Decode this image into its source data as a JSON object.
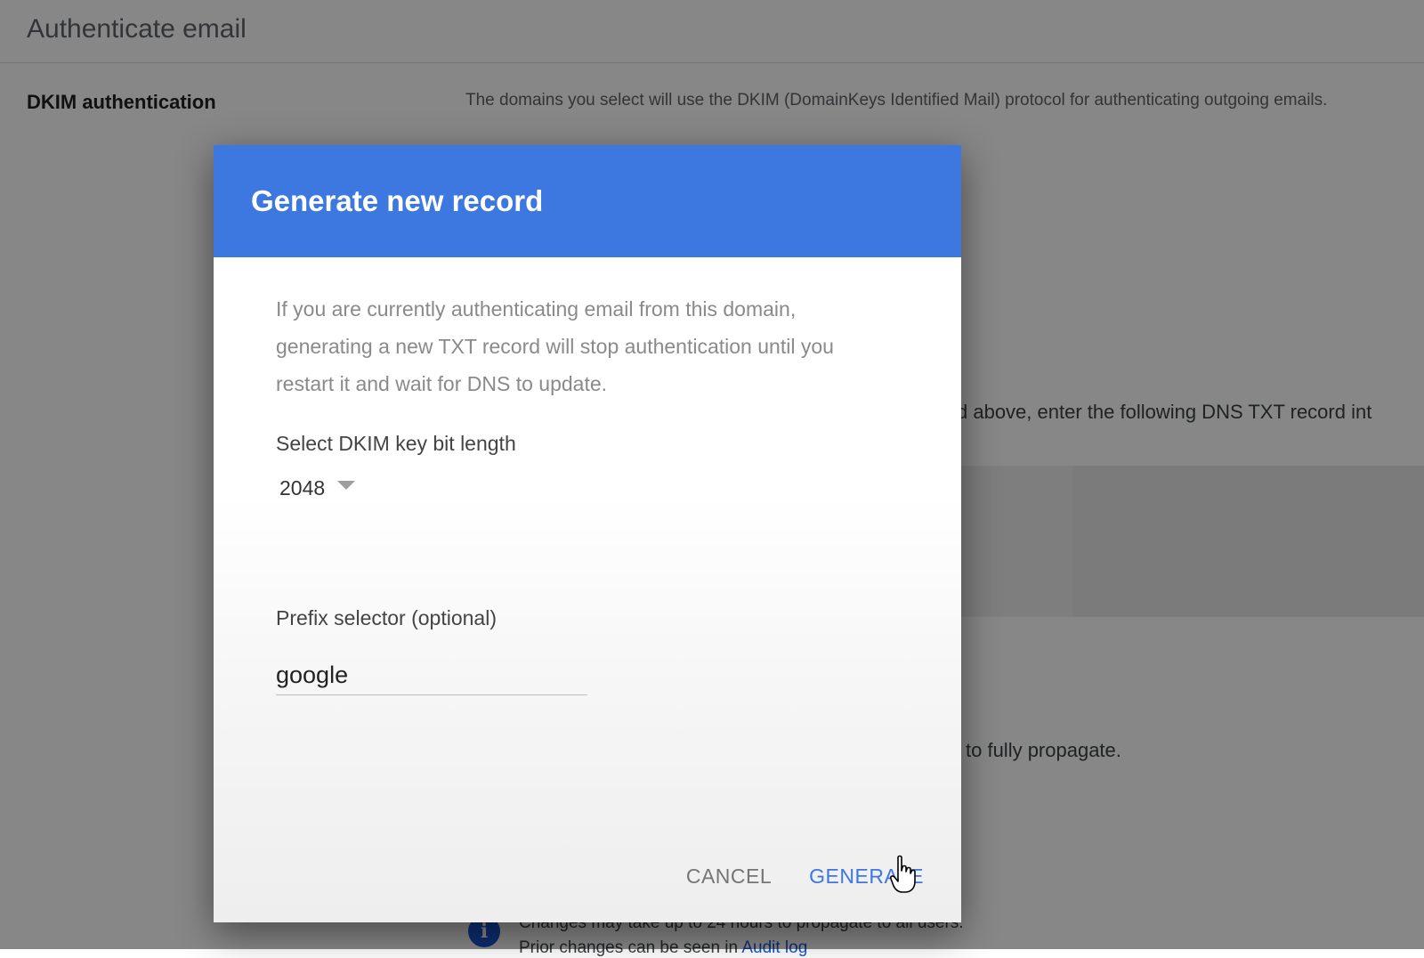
{
  "page": {
    "title": "Authenticate email",
    "section_label": "DKIM authentication",
    "section_description": "The domains you select will use the DKIM (DomainKeys Identified Mail) protocol for authenticating outgoing emails.",
    "dns_instruction_fragment": "d above, enter the following DNS TXT record int",
    "propagate_fragment": "to fully propagate.",
    "notice_line1": "Changes may take up to 24 hours to propagate to all users.",
    "notice_line2_prefix": "Prior changes can be seen in ",
    "notice_link": "Audit log"
  },
  "dialog": {
    "title": "Generate new record",
    "warning": "If you are currently authenticating email from this domain, generating a new TXT record will stop authentication until you restart it and wait for DNS to update.",
    "key_length_label": "Select DKIM key bit length",
    "key_length_value": "2048",
    "prefix_label": "Prefix selector (optional)",
    "prefix_value": "google",
    "cancel_label": "CANCEL",
    "generate_label": "GENERATE"
  },
  "colors": {
    "dialog_header": "#3c78e0",
    "primary_button": "#3c78e0",
    "scrim": "rgba(0,0,0,0.47)"
  },
  "icons": [
    "dropdown-caret-icon",
    "info-icon",
    "hand-pointer-cursor-icon"
  ]
}
